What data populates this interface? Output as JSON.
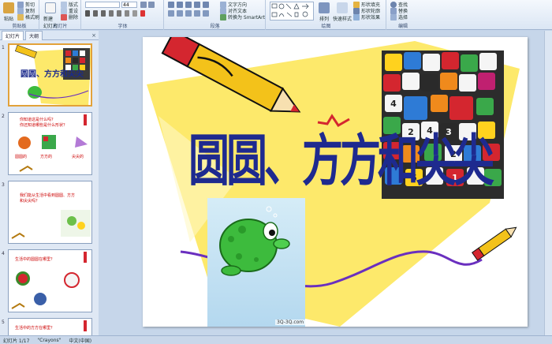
{
  "ribbon": {
    "clipboard": {
      "paste": "粘贴",
      "cut": "剪切",
      "copy": "复制",
      "format_painter": "格式刷",
      "label": "剪贴板"
    },
    "slides": {
      "new_slide": "新建\n幻灯片",
      "layout": "版式",
      "reset": "重设",
      "delete": "删除",
      "label": "幻灯片"
    },
    "font": {
      "font_size": "44",
      "label": "字体"
    },
    "paragraph": {
      "text_direction": "文字方向",
      "align_text": "对齐文本",
      "smartart": "转换为 SmartArt",
      "label": "段落"
    },
    "drawing": {
      "arrange": "排列",
      "quick_styles": "快速样式",
      "shape_fill": "形状填充",
      "shape_outline": "形状轮廓",
      "shape_effects": "形状效果",
      "label": "绘图"
    },
    "editing": {
      "find": "查找",
      "replace": "替换",
      "select": "选择",
      "label": "编辑"
    }
  },
  "pane": {
    "tab_slides": "幻灯片",
    "tab_outline": "大纲",
    "close": "×"
  },
  "thumbnails": [
    {
      "num": "1",
      "title": "圆圆、方方和尖尖"
    },
    {
      "num": "2",
      "line1": "你知道这是什么吗？",
      "line2": "你还知道哪些是什么形状？",
      "labels": [
        "圆圆的",
        "方方的",
        "尖尖的"
      ]
    },
    {
      "num": "3",
      "line1": "我们能从生活中看到圆圆、方方",
      "line2": "和尖尖吗？"
    },
    {
      "num": "4",
      "line1": "生活中的圆圆在哪里？"
    },
    {
      "num": "5",
      "line1": "生活中的方方在哪里？"
    }
  ],
  "slide": {
    "title": "圆圆、方方和尖尖",
    "watermark": "3Q-3Q.com",
    "dice_numbers": [
      "4",
      "2",
      "4",
      "3",
      "2",
      "5",
      "1"
    ]
  },
  "status": {
    "slide_info": "幻灯片 1/17",
    "theme": "\"Crayons\"",
    "language": "中文(中国)"
  },
  "colors": {
    "title": "#1e2a8f",
    "pencil": "#f3c21a",
    "accent_red": "#d4262f",
    "purple_line": "#6a2fbf",
    "background_yellow": "#fde96b"
  }
}
